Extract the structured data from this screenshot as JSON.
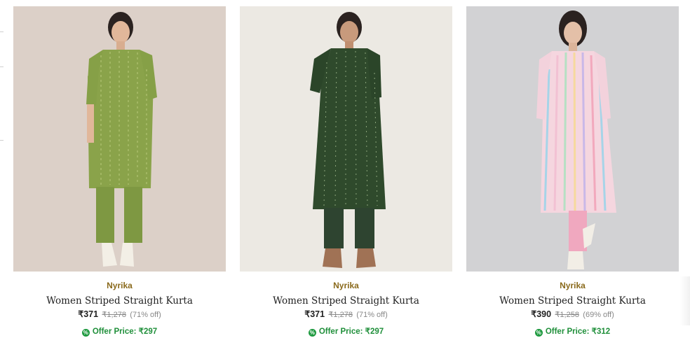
{
  "products": [
    {
      "brand": "Nyrika",
      "title": "Women Striped Straight Kurta",
      "price": "₹371",
      "mrp": "₹1,278",
      "discount": "(71% off)",
      "offer": "Offer Price: ₹297",
      "image": {
        "bg": "#dcd0c8",
        "kurta": "#8aa34a",
        "pants": "#7e9842",
        "shoes": "#f3efe6"
      }
    },
    {
      "brand": "Nyrika",
      "title": "Women Striped Straight Kurta",
      "price": "₹371",
      "mrp": "₹1,278",
      "discount": "(71% off)",
      "offer": "Offer Price: ₹297",
      "image": {
        "bg": "#ece9e3",
        "kurta": "#2f4a2c",
        "pants": "#2e4430",
        "shoes": "#a07255"
      }
    },
    {
      "brand": "Nyrika",
      "title": "Women Striped Straight Kurta",
      "price": "₹390",
      "mrp": "₹1,258",
      "discount": "(69% off)",
      "offer": "Offer Price: ₹312",
      "image": {
        "bg": "#d2d2d4",
        "kurta": "#f5d6df",
        "pants": "#f0a8bf",
        "shoes": "#f2eee6"
      }
    }
  ],
  "colors": {
    "brand": "#8a6a1c",
    "offer": "#1f8f3a"
  }
}
